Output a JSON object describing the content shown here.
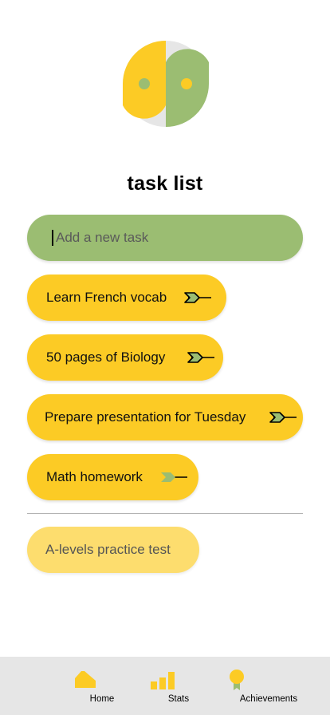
{
  "header": {
    "title": "task list"
  },
  "logo": {
    "icon": "yin-yang-logo",
    "colors": {
      "yellow": "#fccb25",
      "green": "#9bbd72",
      "gray": "#e6e6e6"
    }
  },
  "new_task": {
    "placeholder": "Add a new task",
    "value": ""
  },
  "tasks": [
    {
      "label": "Learn French vocab",
      "icon": "arrow-icon",
      "arrow_color": "#9bbd72"
    },
    {
      "label": "50 pages of Biology",
      "icon": "arrow-icon",
      "arrow_color": "#9bbd72"
    },
    {
      "label": "Prepare presentation for Tuesday",
      "icon": "arrow-icon",
      "arrow_color": "#9bbd72"
    },
    {
      "label": "Math homework",
      "icon": "arrow-icon",
      "arrow_color": "#9bbd72"
    }
  ],
  "completed_tasks": [
    {
      "label": "A-levels practice test"
    }
  ],
  "nav": {
    "items": [
      {
        "label": "Home",
        "icon": "home-icon"
      },
      {
        "label": "Stats",
        "icon": "stats-icon"
      },
      {
        "label": "Achievements",
        "icon": "achievement-badge-icon"
      }
    ]
  },
  "colors": {
    "accent": "#fccb25",
    "accent_light": "#fddd6e",
    "green": "#9bbd72",
    "nav_bg": "#e6e6e6"
  }
}
